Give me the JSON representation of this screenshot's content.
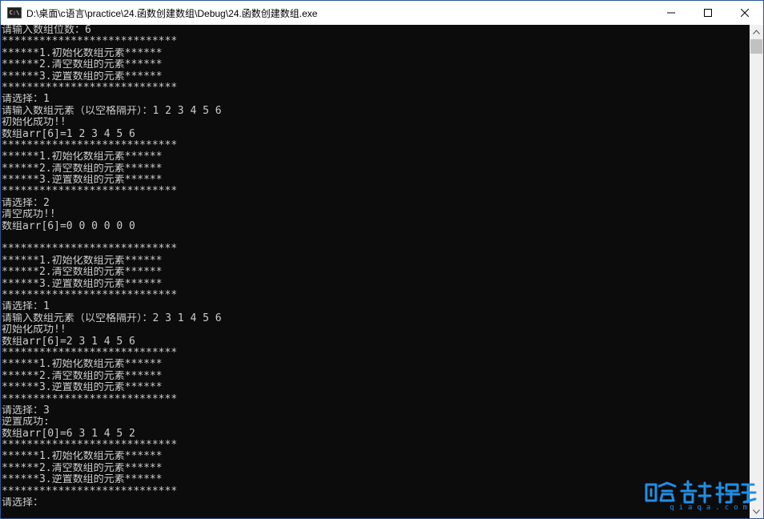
{
  "window": {
    "title": "D:\\桌面\\c语言\\practice\\24.函数创建数组\\Debug\\24.函数创建数组.exe",
    "app_icon_text": "C:\\",
    "controls": [
      "minimize-icon",
      "maximize-icon",
      "close-icon"
    ]
  },
  "console": {
    "lines": [
      "请输入数组位数：6",
      "****************************",
      "******1.初始化数组元素******",
      "******2.清空数组的元素******",
      "******3.逆置数组的元素******",
      "****************************",
      "请选择：1",
      "请输入数组元素（以空格隔开）：1 2 3 4 5 6",
      "初始化成功!!",
      "数组arr[6]=1 2 3 4 5 6",
      "****************************",
      "******1.初始化数组元素******",
      "******2.清空数组的元素******",
      "******3.逆置数组的元素******",
      "****************************",
      "请选择：2",
      "清空成功!!",
      "数组arr[6]=0 0 0 0 0 0",
      "",
      "****************************",
      "******1.初始化数组元素******",
      "******2.清空数组的元素******",
      "******3.逆置数组的元素******",
      "****************************",
      "请选择：1",
      "请输入数组元素（以空格隔开）：2 3 1 4 5 6",
      "初始化成功!!",
      "数组arr[6]=2 3 1 4 5 6",
      "****************************",
      "******1.初始化数组元素******",
      "******2.清空数组的元素******",
      "******3.逆置数组的元素******",
      "****************************",
      "请选择：3",
      "逆置成功:",
      "数组arr[0]=6 3 1 4 5 2",
      "****************************",
      "******1.初始化数组元素******",
      "******2.清空数组的元素******",
      "******3.逆置数组的元素******",
      "****************************",
      "请选择："
    ]
  },
  "watermark": {
    "domain": "qiaqa.com"
  },
  "colors": {
    "console_bg": "#0c0c0c",
    "console_fg": "#cccccc",
    "titlebar_bg": "#ffffff",
    "watermark": "#1f8fe6"
  }
}
